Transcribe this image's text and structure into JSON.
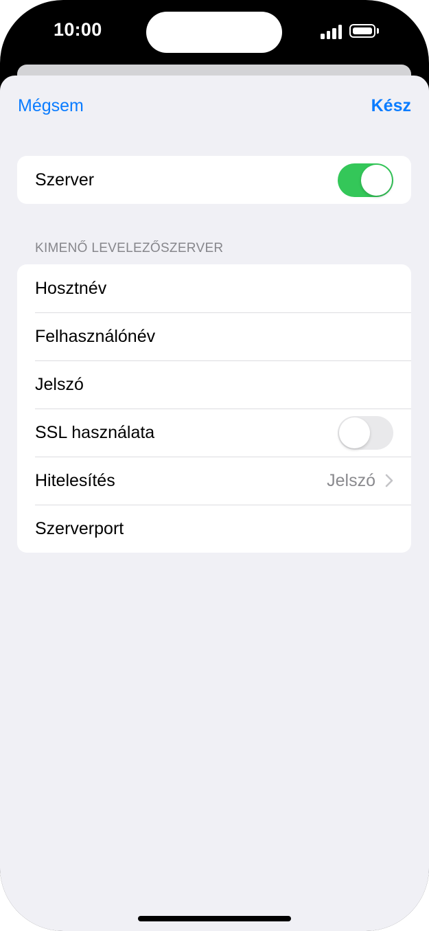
{
  "status_bar": {
    "time": "10:00"
  },
  "nav": {
    "cancel_label": "Mégsem",
    "done_label": "Kész"
  },
  "server_card": {
    "label": "Szerver",
    "toggle_on": true
  },
  "outgoing_section": {
    "header": "KIMENŐ LEVELEZŐSZERVER",
    "rows": {
      "hostname": "Hosztnév",
      "username": "Felhasználónév",
      "password": "Jelszó",
      "ssl": {
        "label": "SSL használata",
        "toggle_on": false
      },
      "auth": {
        "label": "Hitelesítés",
        "value": "Jelszó"
      },
      "port": "Szerverport"
    }
  },
  "colors": {
    "accent": "#0a7cff",
    "toggle_on": "#34c759",
    "toggle_off": "#e9e9eb",
    "background": "#f0f0f5"
  },
  "icons": [
    "signal-icon",
    "battery-icon",
    "chevron-right-icon"
  ]
}
